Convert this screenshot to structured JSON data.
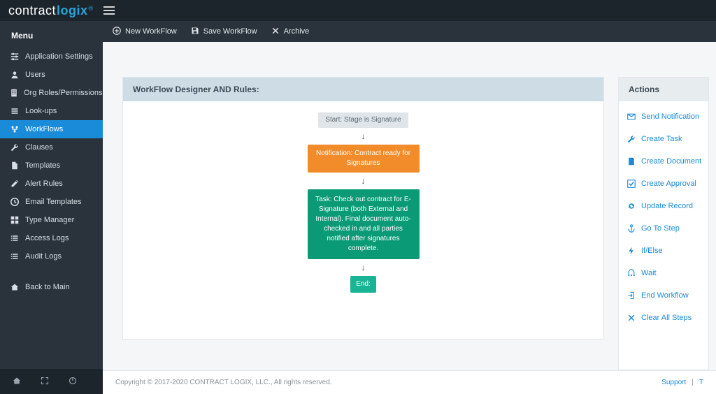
{
  "brand": {
    "part1": "contract",
    "part2": "logix",
    "reg": "®"
  },
  "sidebar": {
    "title": "Menu",
    "items": [
      {
        "icon": "sliders",
        "label": "Application Settings"
      },
      {
        "icon": "user",
        "label": "Users"
      },
      {
        "icon": "building",
        "label": "Org Roles/Permissions"
      },
      {
        "icon": "list",
        "label": "Look-ups"
      },
      {
        "icon": "flow",
        "label": "WorkFlows",
        "active": true
      },
      {
        "icon": "wrench",
        "label": "Clauses"
      },
      {
        "icon": "file",
        "label": "Templates"
      },
      {
        "icon": "edit",
        "label": "Alert Rules"
      },
      {
        "icon": "clock",
        "label": "Email Templates"
      },
      {
        "icon": "grid",
        "label": "Type Manager"
      },
      {
        "icon": "list2",
        "label": "Access Logs"
      },
      {
        "icon": "list2",
        "label": "Audit Logs"
      }
    ],
    "back": {
      "icon": "home",
      "label": "Back to Main"
    }
  },
  "actionbar": {
    "items": [
      {
        "icon": "plus-circle",
        "label": "New WorkFlow"
      },
      {
        "icon": "save",
        "label": "Save WorkFlow"
      },
      {
        "icon": "archive",
        "label": "Archive"
      }
    ]
  },
  "designer": {
    "header": "WorkFlow Designer AND Rules:",
    "nodes": {
      "start": "Start: Stage is Signature",
      "notification": "Notification: Contract ready for Signatures",
      "task": "Task: Check out contract for E-Signature (both External and Internal). Final document auto-checked in and all parties notified after signatures complete.",
      "end": "End:"
    }
  },
  "actions": {
    "header": "Actions",
    "items": [
      {
        "icon": "mail",
        "label": "Send Notification"
      },
      {
        "icon": "wrench",
        "label": "Create Task"
      },
      {
        "icon": "file",
        "label": "Create Document"
      },
      {
        "icon": "check",
        "label": "Create Approval"
      },
      {
        "icon": "refresh",
        "label": "Update Record"
      },
      {
        "icon": "anchor",
        "label": "Go To Step"
      },
      {
        "icon": "bolt",
        "label": "If/Else"
      },
      {
        "icon": "more",
        "label": "Wait"
      },
      {
        "icon": "exit",
        "label": "End Workflow"
      },
      {
        "icon": "times",
        "label": "Clear All Steps"
      }
    ]
  },
  "footer": {
    "copyright": "Copyright © 2017-2020 CONTRACT LOGIX, LLC., All rights reserved.",
    "links": {
      "support": "Support",
      "sep": "|",
      "tail": "T"
    }
  }
}
